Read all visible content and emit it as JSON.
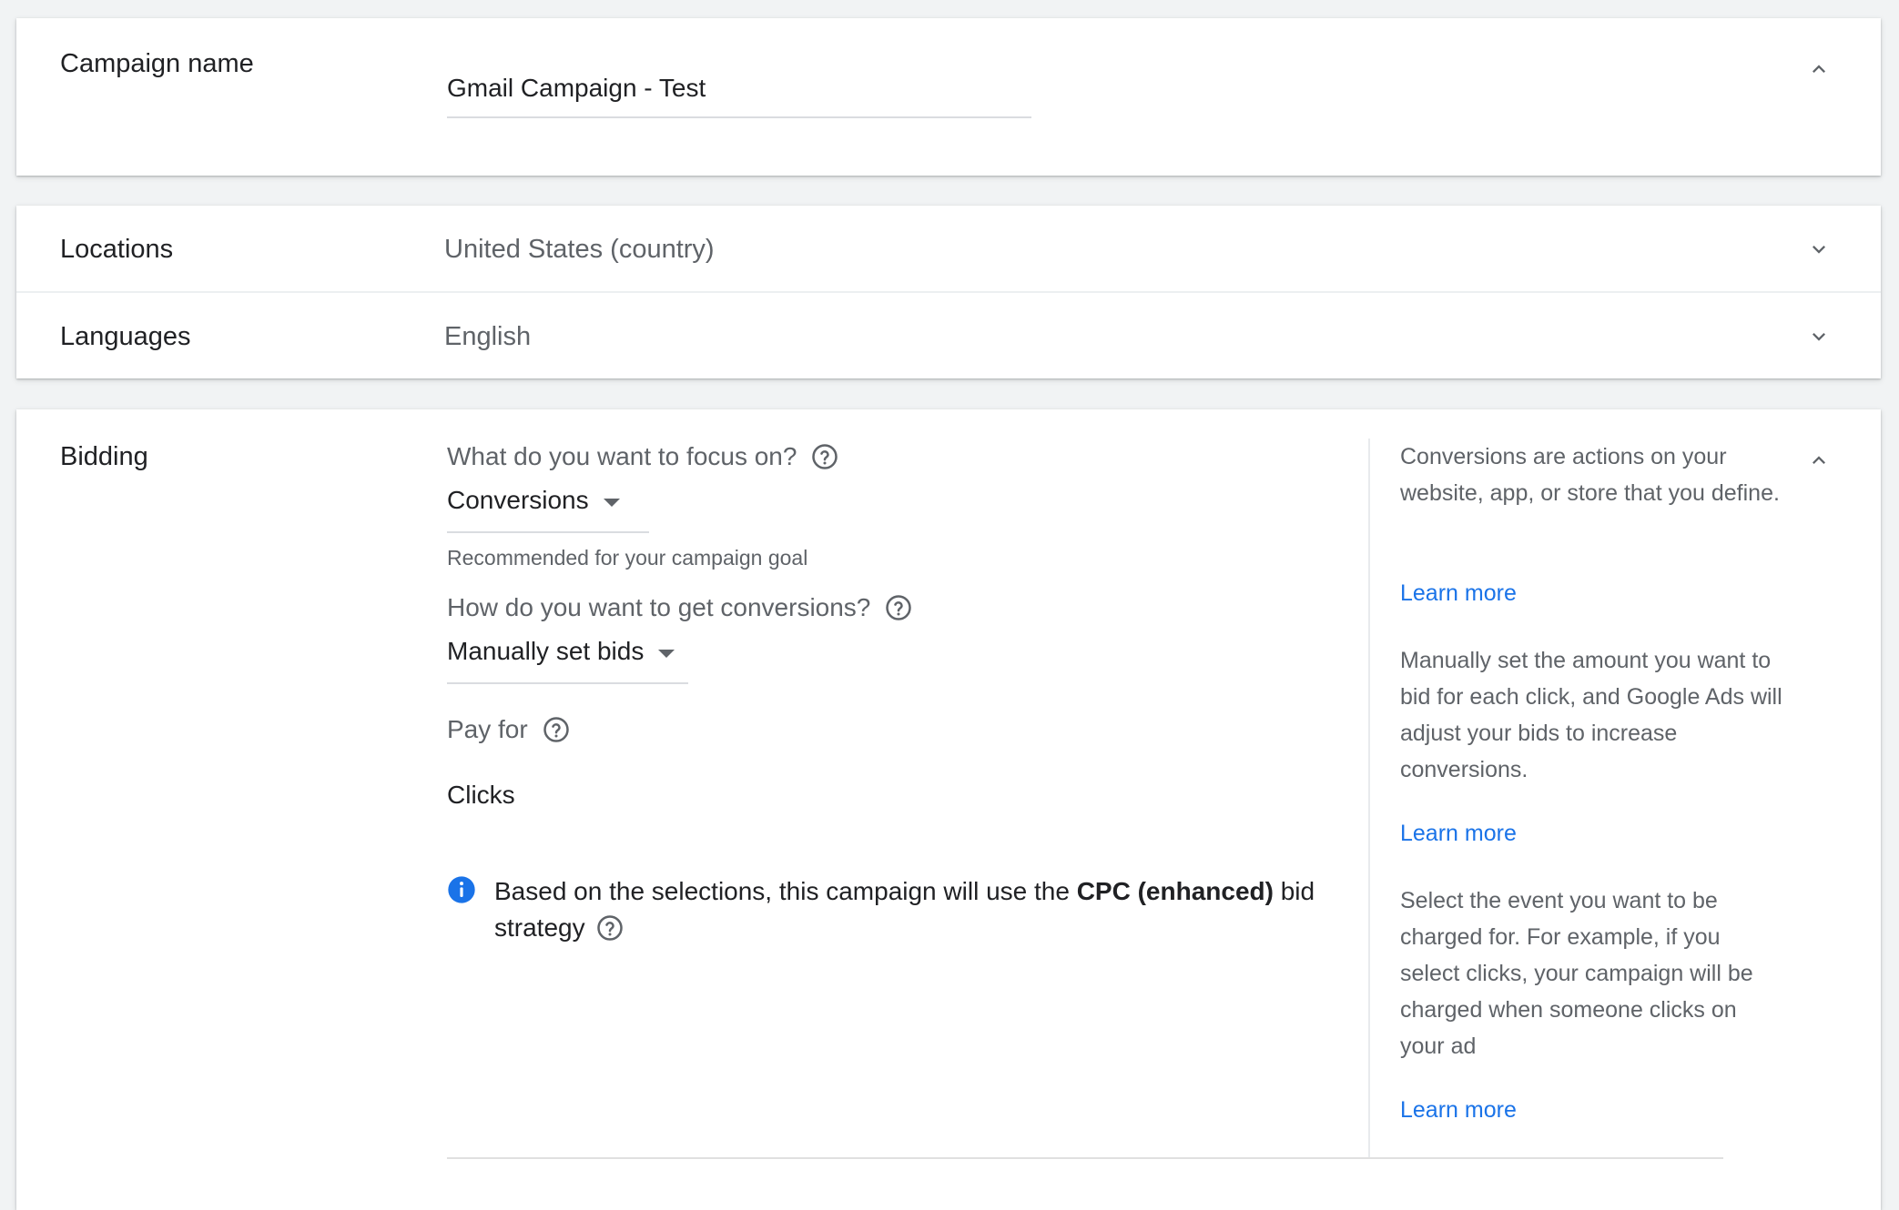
{
  "campaign_name": {
    "label": "Campaign name",
    "value": "Gmail Campaign - Test"
  },
  "locations": {
    "label": "Locations",
    "value": "United States (country)"
  },
  "languages": {
    "label": "Languages",
    "value": "English"
  },
  "bidding": {
    "label": "Bidding",
    "focus_question": "What do you want to focus on?",
    "focus_value": "Conversions",
    "focus_hint": "Recommended for your campaign goal",
    "conversions_question": "How do you want to get conversions?",
    "conversions_value": "Manually set bids",
    "pay_for_label": "Pay for",
    "pay_for_value": "Clicks",
    "info_prefix": "Based on the selections, this campaign will use the ",
    "info_strategy": "CPC (enhanced)",
    "info_suffix": " bid strategy",
    "help": [
      {
        "text": "Conversions are actions on your website, app, or store that you define.",
        "link": "Learn more"
      },
      {
        "text": "Manually set the amount you want to bid for each click, and Google Ads will adjust your bids to increase conversions.",
        "link": "Learn more"
      },
      {
        "text": "Select the event you want to be charged for. For example, if you select clicks, your campaign will be charged when someone clicks on your ad",
        "link": "Learn more"
      }
    ]
  },
  "colors": {
    "link": "#1a73e8",
    "info_icon": "#1a73e8",
    "secondary_text": "#5f6368",
    "primary_text": "#202124"
  },
  "icons": {
    "expand": "chevron-down-icon",
    "collapse": "chevron-up-icon",
    "help": "help-circle-icon",
    "info": "info-icon"
  }
}
